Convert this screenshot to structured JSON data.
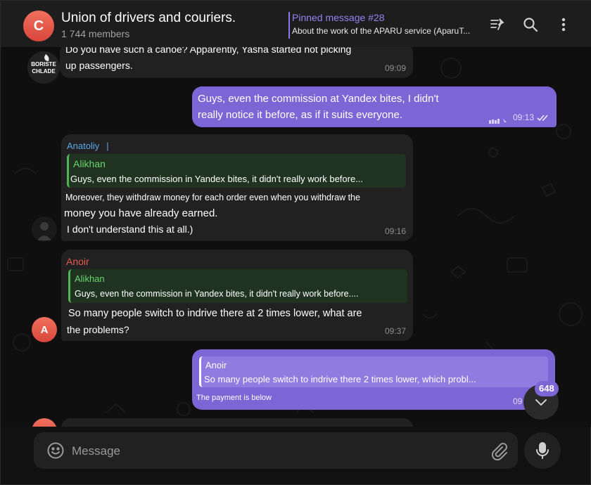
{
  "header": {
    "avatar_letter": "C",
    "title": "Union of drivers and couriers.",
    "subtitle": "1 744 members",
    "pinned_title": "Pinned message #28",
    "pinned_text": "About the work of the APARU service (AparuT..."
  },
  "messages": [
    {
      "sender_avatar_text": "BORISTE CHLADE",
      "line1": "Do you have such a canoe? Apparently, Yasha started not picking",
      "line2": "up passengers.",
      "time": "09:09"
    },
    {
      "line1": "Guys, even the commission at Yandex bites, I didn't",
      "line2": "really notice it before, as if it suits everyone.",
      "time": "09:13"
    },
    {
      "sender": "Anatoliy",
      "reply_name": "Alikhan",
      "reply_text": "Guys, even the commission in Yandex bites, it didn't really work before...",
      "line1": "Moreover, they withdraw money for each order even when you withdraw the",
      "line2": "money you have already earned.",
      "line3": "I don't understand this at all.)",
      "time": "09:16"
    },
    {
      "sender": "Anoir",
      "avatar_letter": "A",
      "reply_name": "Alikhan",
      "reply_text": "Guys, even the commission in Yandex bites, it didn't really work before....",
      "line1": "So many people switch to indrive there at 2 times lower, what are",
      "line2": "the problems?",
      "time": "09:37"
    },
    {
      "reply_name": "Anoir",
      "reply_text": "So many people switch to indrive there 2 times lower, which probl...",
      "line1": "The payment is below",
      "time": "09"
    }
  ],
  "scroll_badge": "648",
  "composer": {
    "placeholder": "Message"
  },
  "colors": {
    "accent": "#7c66d6",
    "sender_anatoliy": "#5aa8e8",
    "sender_anoir": "#e85a4f",
    "reply_green": "#4eb654"
  }
}
